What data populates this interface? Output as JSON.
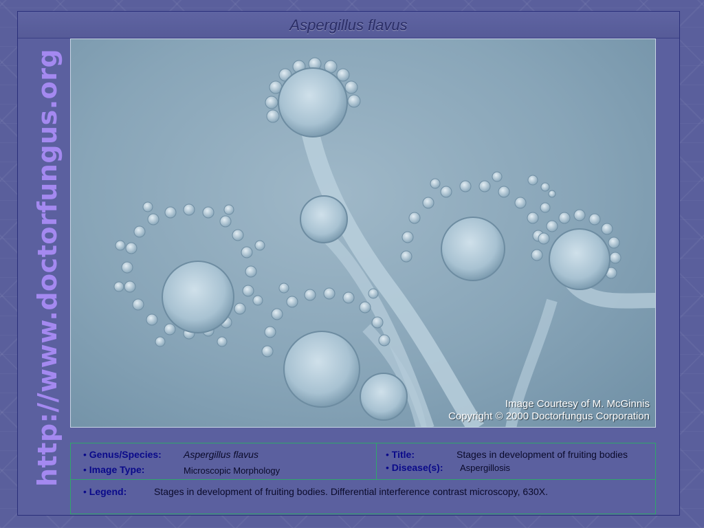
{
  "side_url": "http://www.doctorfungus.org",
  "slide": {
    "title": "Aspergillus flavus"
  },
  "image": {
    "credit_line1": "Image Courtesy of M. McGinnis",
    "credit_line2": "Copyright © 2000 Doctorfungus Corporation"
  },
  "info": {
    "bullet": "•",
    "genus_label": "Genus/Species:",
    "genus_value": "Aspergillus flavus",
    "image_type_label": "Image Type:",
    "image_type_value": "Microscopic Morphology",
    "title_label": "Title:",
    "title_value": "Stages in development of fruiting bodies",
    "disease_label": "Disease(s):",
    "disease_value": "Aspergillosis",
    "legend_label": "Legend:",
    "legend_value": "Stages in development of fruiting bodies. Differential interference contrast microscopy, 630X."
  },
  "colors": {
    "background": "#5b609f",
    "url_text": "#a489f0",
    "label_text": "#0a0a8a",
    "table_border": "#2fa86a"
  }
}
